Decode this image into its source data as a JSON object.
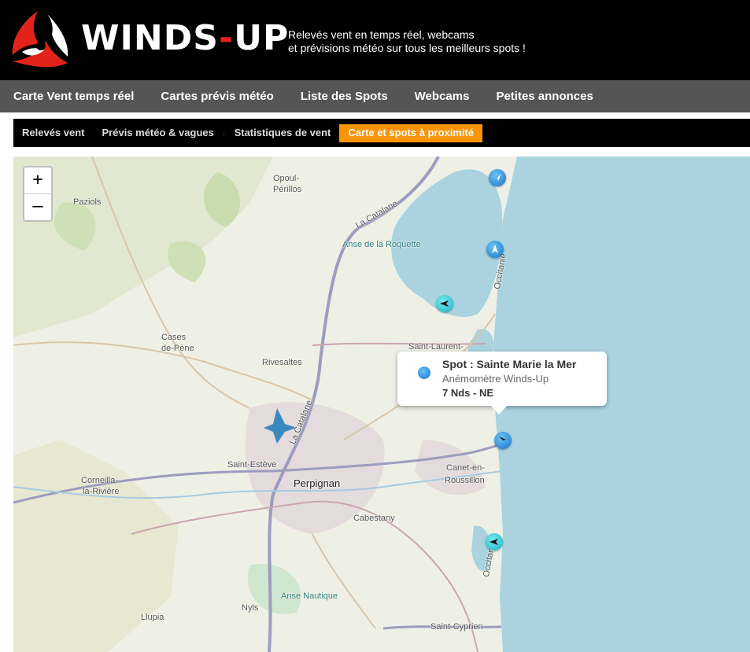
{
  "brand": {
    "prefix": "WINDS",
    "dash": "-",
    "suffix": "UP"
  },
  "tagline": {
    "line1": "Relevés vent en temps réel, webcams",
    "line2": "et prévisions météo sur tous les meilleurs spots !"
  },
  "main_nav": [
    {
      "label": "Carte Vent temps réel"
    },
    {
      "label": "Cartes prévis météo"
    },
    {
      "label": "Liste des Spots"
    },
    {
      "label": "Webcams"
    },
    {
      "label": "Petites annonces"
    }
  ],
  "sub_nav": [
    {
      "label": "Relevés vent"
    },
    {
      "label": "Prévis météo & vagues"
    },
    {
      "label": "Statistiques de vent"
    },
    {
      "label": "Carte et spots à proximité",
      "active": true
    }
  ],
  "map": {
    "zoom_in": "+",
    "zoom_out": "–",
    "places": {
      "opoul": "Opoul-",
      "perillos": "Périllos",
      "paziols": "Paziols",
      "la_catalane_n": "La Catalane",
      "anse_roquette": "Anse de la Roquette",
      "occitanie_n": "Occitanie",
      "cases_de_pene_1": "Cases",
      "cases_de_pene_2": "de-Pène",
      "rivesaltes": "Rivesaltes",
      "saint_laurent": "Saint-Laurent-",
      "la_catalane_s": "La Catalane",
      "saint_esteve": "Saint-Estève",
      "perpignan": "Perpignan",
      "canet_1": "Canet-en-",
      "canet_2": "Roussillon",
      "corneilla_1": "Corneilla-",
      "corneilla_2": "la-Rivière",
      "cabestany": "Cabestany",
      "occitanie_s": "Occitanie",
      "anse_nautique": "Anse Nautique",
      "nyls": "Nyls",
      "llupia": "Llupia",
      "saint_cyprien": "Saint-Cyprien"
    },
    "popup": {
      "title": "Spot : Sainte Marie la Mer",
      "subtitle": "Anémomètre Winds-Up",
      "reading": "7 Nds - NE"
    },
    "markers": [
      {
        "name": "spot-marker-leucate",
        "color": "#1a73c9"
      },
      {
        "name": "spot-marker-leucate-plage",
        "color": "#1a73c9"
      },
      {
        "name": "spot-marker-etang",
        "color": "#17b3c8"
      },
      {
        "name": "spot-marker-sainte-marie",
        "color": "#1a73c9"
      },
      {
        "name": "spot-marker-saint-cyprien",
        "color": "#17b3c8"
      }
    ],
    "colors": {
      "sea": "#aad3df",
      "land": "#eef0e6",
      "highlight": "#f89406"
    }
  }
}
